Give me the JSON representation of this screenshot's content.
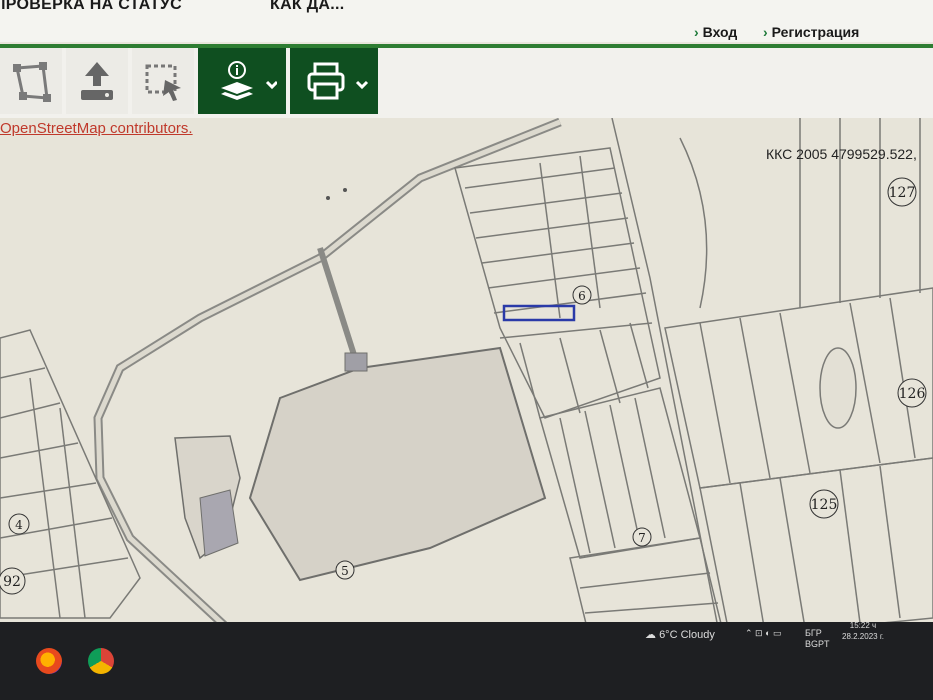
{
  "header": {
    "nav_left": "ПРОВЕРКА НА СТАТУС",
    "nav_mid": "КАК ДА...",
    "login": "Вход",
    "register": "Регистрация"
  },
  "toolbar": {
    "tools": [
      {
        "icon": "draw-polygon-icon"
      },
      {
        "icon": "upload-icon"
      },
      {
        "icon": "select-area-icon"
      },
      {
        "icon": "layers-info-icon"
      },
      {
        "icon": "print-icon"
      }
    ]
  },
  "map": {
    "attribution": "OpenStreetMap contributors.",
    "coords": "ККС 2005 4799529.522,",
    "labels": {
      "l127": "127",
      "l6": "6",
      "l126": "126",
      "l125": "125",
      "l7": "7",
      "l5": "5",
      "l4": "4",
      "l92": "92"
    }
  },
  "taskbar": {
    "weather": "6°C  Cloudy",
    "lang": "БГР",
    "lang2": "BGPT",
    "time": "15:22 ч",
    "date": "28.2.2023 г."
  },
  "colors": {
    "accent": "#2e7d32",
    "toolbar_dark": "#0f4f20",
    "selected_parcel": "#2a3aa8"
  }
}
